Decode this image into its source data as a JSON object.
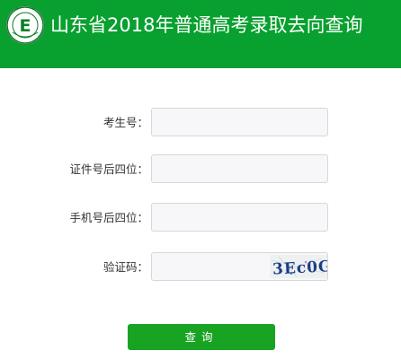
{
  "header": {
    "title": "山东省2018年普通高考录取去向查询",
    "logo_icon": "exam-authority-seal-icon",
    "background_color": "#08a02f"
  },
  "form": {
    "fields": [
      {
        "label": "考生号：",
        "value": "",
        "placeholder": ""
      },
      {
        "label": "证件号后四位：",
        "value": "",
        "placeholder": ""
      },
      {
        "label": "手机号后四位：",
        "value": "",
        "placeholder": ""
      },
      {
        "label": "验证码：",
        "value": "",
        "placeholder": ""
      }
    ],
    "captcha_text": "3Ec0G",
    "submit_label": "查询",
    "submit_color": "#18a323"
  }
}
